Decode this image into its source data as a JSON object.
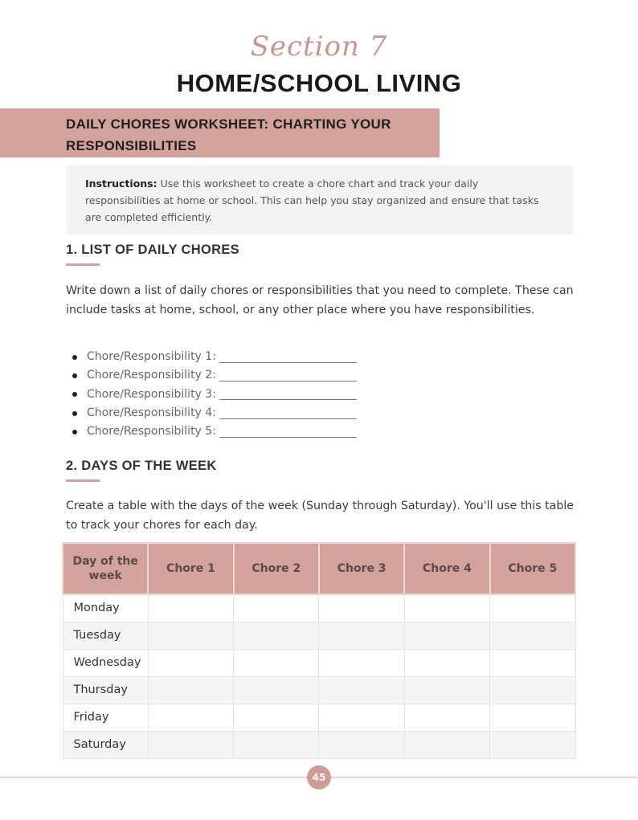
{
  "header": {
    "section_label": "Section 7",
    "title": "HOME/SCHOOL LIVING"
  },
  "banner": {
    "line1": "DAILY CHORES WORKSHEET: CHARTING YOUR",
    "line2": "RESPONSIBILITIES"
  },
  "instructions": {
    "label": "Instructions:",
    "text": " Use this worksheet to create a chore chart and track your daily responsibilities at home or school. This can help you stay organized and ensure that tasks are completed efficiently."
  },
  "section1": {
    "heading": "1. LIST OF DAILY CHORES",
    "body": "Write down a list of daily chores or responsibilities that you need to complete. These can include tasks at home, school, or any other place where you have responsibilities.",
    "items": [
      {
        "label": "Chore/Responsibility 1:",
        "value": ""
      },
      {
        "label": "Chore/Responsibility 2:",
        "value": ""
      },
      {
        "label": "Chore/Responsibility 3:",
        "value": ""
      },
      {
        "label": "Chore/Responsibility 4:",
        "value": ""
      },
      {
        "label": "Chore/Responsibility 5:",
        "value": ""
      }
    ]
  },
  "section2": {
    "heading": "2. DAYS OF THE WEEK",
    "body": "Create a table with the days of the week (Sunday through Saturday). You'll use this table to track your chores for each day.",
    "table": {
      "headers": [
        "Day of the week",
        "Chore 1",
        "Chore 2",
        "Chore 3",
        "Chore 4",
        "Chore 5"
      ],
      "rows": [
        [
          "Monday",
          "",
          "",
          "",
          "",
          ""
        ],
        [
          "Tuesday",
          "",
          "",
          "",
          "",
          ""
        ],
        [
          "Wednesday",
          "",
          "",
          "",
          "",
          ""
        ],
        [
          "Thursday",
          "",
          "",
          "",
          "",
          ""
        ],
        [
          "Friday",
          "",
          "",
          "",
          "",
          ""
        ],
        [
          "Saturday",
          "",
          "",
          "",
          "",
          ""
        ]
      ]
    }
  },
  "footer": {
    "page_number": "45"
  },
  "colors": {
    "accent": "#d4a29c",
    "script_title": "#c9958f",
    "instructions_bg": "#f3f3f3"
  }
}
